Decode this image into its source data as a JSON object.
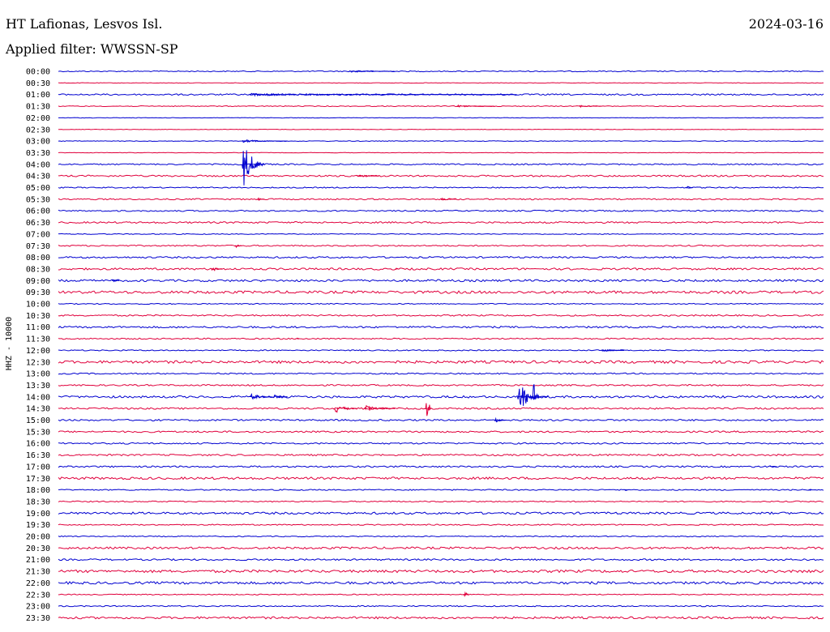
{
  "header": {
    "station": "HT Lafionas, Lesvos Isl.",
    "date": "2024-03-16",
    "filter": "Applied filter: WWSSN-SP"
  },
  "chart_data": {
    "type": "line",
    "title": "HT Lafionas, Lesvos Isl.",
    "subtitle": "Applied filter: WWSSN-SP",
    "ylabel": "HHZ - 10000",
    "xlabel": "",
    "colors": [
      "#0000d0",
      "#e0003c"
    ],
    "rows": [
      "00:00",
      "00:30",
      "01:00",
      "01:30",
      "02:00",
      "02:30",
      "03:00",
      "03:30",
      "04:00",
      "04:30",
      "05:00",
      "05:30",
      "06:00",
      "06:30",
      "07:00",
      "07:30",
      "08:00",
      "08:30",
      "09:00",
      "09:30",
      "10:00",
      "10:30",
      "11:00",
      "11:30",
      "12:00",
      "12:30",
      "13:00",
      "13:30",
      "14:00",
      "14:30",
      "15:00",
      "15:30",
      "16:00",
      "16:30",
      "17:00",
      "17:30",
      "18:00",
      "18:30",
      "19:00",
      "19:30",
      "20:00",
      "20:30",
      "21:00",
      "21:30",
      "22:00",
      "22:30",
      "23:00",
      "23:30"
    ],
    "noise": [
      0.6,
      0.3,
      0.9,
      0.5,
      0.3,
      0.3,
      0.4,
      0.3,
      0.8,
      1.0,
      0.7,
      0.8,
      0.8,
      1.0,
      0.5,
      0.8,
      1.0,
      1.2,
      1.3,
      1.6,
      0.6,
      0.9,
      1.1,
      0.8,
      0.7,
      1.6,
      0.8,
      0.9,
      1.3,
      1.0,
      1.0,
      1.0,
      0.9,
      1.0,
      1.0,
      1.4,
      0.7,
      0.7,
      1.3,
      0.7,
      0.6,
      1.3,
      1.0,
      1.6,
      1.5,
      0.6,
      0.7,
      1.3
    ],
    "events": [
      {
        "row": "00:00",
        "x": 0.38,
        "amp": 1.5,
        "dur": 0.06
      },
      {
        "row": "01:00",
        "x": 0.25,
        "amp": 1.5,
        "dur": 0.35
      },
      {
        "row": "01:30",
        "x": 0.52,
        "amp": 1.5,
        "dur": 0.05
      },
      {
        "row": "01:30",
        "x": 0.68,
        "amp": 1.5,
        "dur": 0.03
      },
      {
        "row": "03:00",
        "x": 0.24,
        "amp": 2,
        "dur": 0.06
      },
      {
        "row": "04:00",
        "x": 0.24,
        "amp": 34,
        "dur": 0.03
      },
      {
        "row": "04:30",
        "x": 0.39,
        "amp": 2,
        "dur": 0.03
      },
      {
        "row": "05:00",
        "x": 0.82,
        "amp": 3,
        "dur": 0.01
      },
      {
        "row": "05:30",
        "x": 0.26,
        "amp": 3,
        "dur": 0.01
      },
      {
        "row": "05:30",
        "x": 0.5,
        "amp": 2,
        "dur": 0.02
      },
      {
        "row": "07:30",
        "x": 0.23,
        "amp": 4,
        "dur": 0.01
      },
      {
        "row": "08:30",
        "x": 0.2,
        "amp": 5,
        "dur": 0.015
      },
      {
        "row": "08:30",
        "x": 0.44,
        "amp": 3,
        "dur": 0.005
      },
      {
        "row": "09:00",
        "x": 0.07,
        "amp": 3,
        "dur": 0.01
      },
      {
        "row": "11:30",
        "x": 0.31,
        "amp": 6,
        "dur": 0.005
      },
      {
        "row": "12:00",
        "x": 0.71,
        "amp": 2,
        "dur": 0.03
      },
      {
        "row": "14:00",
        "x": 0.25,
        "amp": 5,
        "dur": 0.03
      },
      {
        "row": "14:00",
        "x": 0.28,
        "amp": 4,
        "dur": 0.02
      },
      {
        "row": "14:00",
        "x": 0.62,
        "amp": 56,
        "dur": 0.005
      },
      {
        "row": "14:00",
        "x": 0.6,
        "amp": 20,
        "dur": 0.04
      },
      {
        "row": "14:30",
        "x": 0.36,
        "amp": 7,
        "dur": 0.03
      },
      {
        "row": "14:30",
        "x": 0.4,
        "amp": 5,
        "dur": 0.04
      },
      {
        "row": "14:30",
        "x": 0.48,
        "amp": 34,
        "dur": 0.008
      },
      {
        "row": "15:00",
        "x": 0.57,
        "amp": 4,
        "dur": 0.015
      },
      {
        "row": "17:00",
        "x": 0.93,
        "amp": 3,
        "dur": 0.01
      },
      {
        "row": "18:00",
        "x": 0.74,
        "amp": 3,
        "dur": 0.005
      },
      {
        "row": "18:00",
        "x": 0.98,
        "amp": 3,
        "dur": 0.005
      },
      {
        "row": "22:30",
        "x": 0.53,
        "amp": 9,
        "dur": 0.006
      }
    ]
  }
}
